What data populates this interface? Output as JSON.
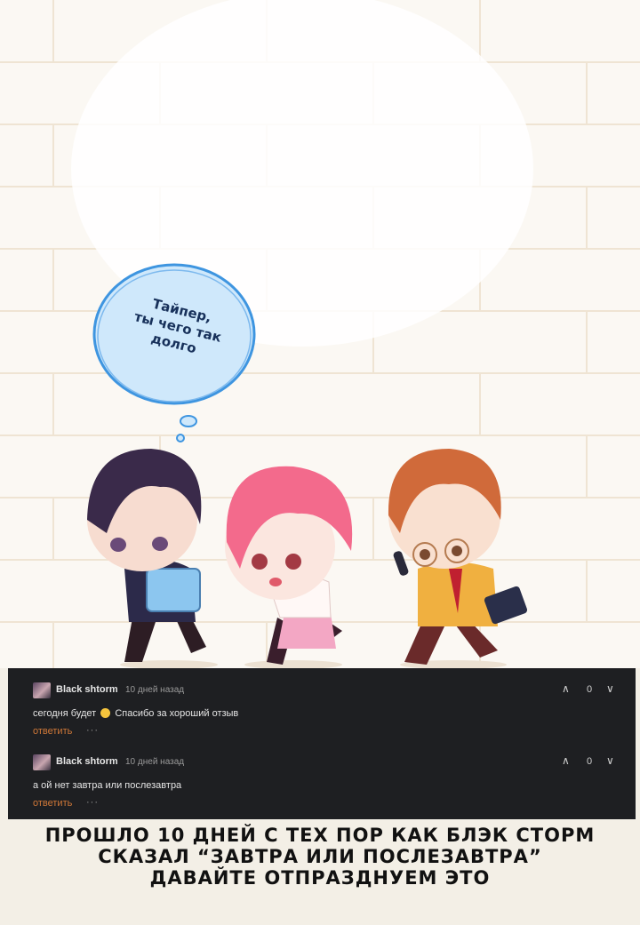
{
  "art": {
    "bubble_lines": [
      "Тайпер,",
      "ты чего так",
      "долго"
    ]
  },
  "comments": [
    {
      "author": "Black shtorm",
      "time": "10 дней назад",
      "score": "0",
      "text_before": "сегодня будет",
      "text_after": "Спасибо за хороший отзыв",
      "reply_label": "ответить",
      "more_label": "···"
    },
    {
      "author": "Black shtorm",
      "time": "10 дней назад",
      "score": "0",
      "text_before": "а ой нет завтра или послезавтра",
      "text_after": "",
      "reply_label": "ответить",
      "more_label": "···"
    }
  ],
  "caption": {
    "line1": "ПРОШЛО 10 ДНЕЙ С ТЕХ ПОР КАК БЛЭК СТОРМ",
    "line2": "СКАЗАЛ “ЗАВТРА ИЛИ ПОСЛЕЗАВТРА”",
    "line3": "ДАВАЙТЕ ОТПРАЗДНУЕМ ЭТО"
  }
}
